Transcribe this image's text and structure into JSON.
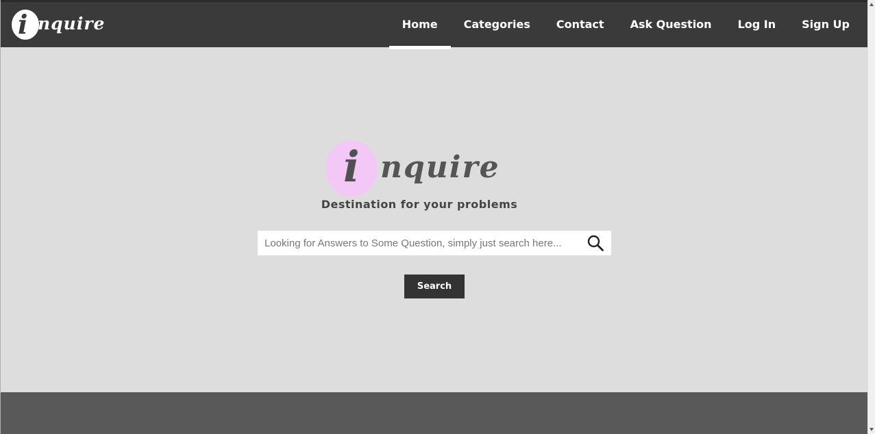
{
  "header": {
    "logo": {
      "initial": "i",
      "rest": "nquire"
    },
    "nav": [
      {
        "label": "Home",
        "active": true
      },
      {
        "label": "Categories",
        "active": false
      },
      {
        "label": "Contact",
        "active": false
      },
      {
        "label": "Ask Question",
        "active": false
      },
      {
        "label": "Log In",
        "active": false
      },
      {
        "label": "Sign Up",
        "active": false
      }
    ]
  },
  "hero": {
    "logo": {
      "initial": "i",
      "rest": "nquire"
    },
    "tagline": "Destination for your problems",
    "search": {
      "placeholder": "Looking for Answers to Some Question, simply just search here...",
      "value": "",
      "icon": "search-icon"
    },
    "button_label": "Search"
  },
  "colors": {
    "header_bg": "#3a3a3a",
    "page_bg": "#dddddd",
    "footer_bg": "#595959",
    "logo_highlight": "#f3c8f6",
    "button_bg": "#333333"
  }
}
